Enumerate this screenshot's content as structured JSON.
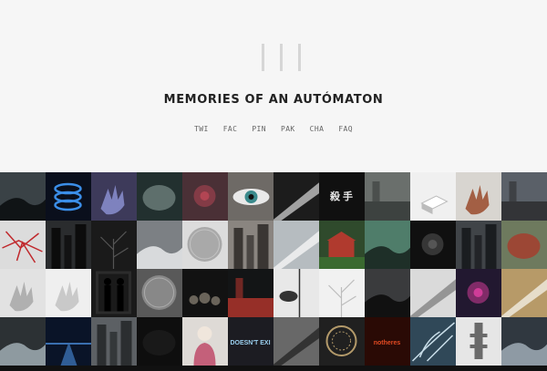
{
  "site": {
    "title": "MEMORIES OF AN AUTÓMATON"
  },
  "nav": [
    {
      "label": "TWI"
    },
    {
      "label": "FAC"
    },
    {
      "label": "PIN"
    },
    {
      "label": "PAK"
    },
    {
      "label": "CHA"
    },
    {
      "label": "FAQ"
    }
  ],
  "grid": {
    "rows": [
      [
        {
          "bg": "#3a4246",
          "accent": "#101416",
          "shape": "hill"
        },
        {
          "bg": "#0a0f1c",
          "accent": "#3b8ee8",
          "shape": "spiral"
        },
        {
          "bg": "#3d3a5a",
          "accent": "#8a8fd0",
          "shape": "hand"
        },
        {
          "bg": "#22302f",
          "accent": "#6e7f7c",
          "shape": "blob"
        },
        {
          "bg": "#4a3036",
          "accent": "#b24553",
          "shape": "glow"
        },
        {
          "bg": "#6e6a66",
          "accent": "#3b8a8c",
          "shape": "eye"
        },
        {
          "bg": "#1c1c1c",
          "accent": "#b8b8b8",
          "shape": "diag"
        },
        {
          "bg": "#101010",
          "accent": "#e6e6e6",
          "shape": "text",
          "text": "殺 手"
        },
        {
          "bg": "#6a6f6c",
          "accent": "#2b2f2e",
          "shape": "room"
        },
        {
          "bg": "#f0f0f0",
          "accent": "#bcbcbc",
          "shape": "box"
        },
        {
          "bg": "#d8d5d0",
          "accent": "#9a4a2c",
          "shape": "hand"
        },
        {
          "bg": "#5a6068",
          "accent": "#222",
          "shape": "room"
        }
      ],
      [
        {
          "bg": "#dcdcdc",
          "accent": "#c0282c",
          "shape": "lines"
        },
        {
          "bg": "#2a2c2e",
          "accent": "#0c0c0c",
          "shape": "towers"
        },
        {
          "bg": "#1a1a1a",
          "accent": "#555",
          "shape": "branch"
        },
        {
          "bg": "#7c8084",
          "accent": "#d8dadc",
          "shape": "hill"
        },
        {
          "bg": "#dcdcdc",
          "accent": "#a9a9a9",
          "shape": "moon"
        },
        {
          "bg": "#8a8580",
          "accent": "#3a3633",
          "shape": "towers"
        },
        {
          "bg": "#b6bcc0",
          "accent": "#f2f2f2",
          "shape": "diag"
        },
        {
          "bg": "#2f4a2c",
          "accent": "#b03a2e",
          "shape": "house"
        },
        {
          "bg": "#4f7d6a",
          "accent": "#1e2f28",
          "shape": "hill"
        },
        {
          "bg": "#101010",
          "accent": "#555",
          "shape": "glow"
        },
        {
          "bg": "#404448",
          "accent": "#1a1d20",
          "shape": "towers"
        },
        {
          "bg": "#6e7a5e",
          "accent": "#a83b2a",
          "shape": "blob"
        }
      ],
      [
        {
          "bg": "#e2e2e2",
          "accent": "#a7a7a7",
          "shape": "hand"
        },
        {
          "bg": "#efefef",
          "accent": "#c2c2c2",
          "shape": "hand"
        },
        {
          "bg": "#1a1a1a",
          "accent": "#2c2c2c",
          "shape": "people"
        },
        {
          "bg": "#595959",
          "accent": "#888",
          "shape": "moon"
        },
        {
          "bg": "#121212",
          "accent": "#6a645a",
          "shape": "dots"
        },
        {
          "bg": "#131516",
          "accent": "#cf3a30",
          "shape": "room"
        },
        {
          "bg": "#e8e8e8",
          "accent": "#333",
          "shape": "lamp"
        },
        {
          "bg": "#f1f1f1",
          "accent": "#bdbdbd",
          "shape": "branch"
        },
        {
          "bg": "#3a3b3d",
          "accent": "#111",
          "shape": "hill"
        },
        {
          "bg": "#dadada",
          "accent": "#888",
          "shape": "diag"
        },
        {
          "bg": "#221830",
          "accent": "#d03c98",
          "shape": "glow"
        },
        {
          "bg": "#b79a68",
          "accent": "#efe9dc",
          "shape": "diag"
        }
      ],
      [
        {
          "bg": "#2c3134",
          "accent": "#8e9aa0",
          "shape": "hill"
        },
        {
          "bg": "#0a1428",
          "accent": "#3a6fb0",
          "shape": "road"
        },
        {
          "bg": "#5c6064",
          "accent": "#2b2e30",
          "shape": "towers"
        },
        {
          "bg": "#0e0e0e",
          "accent": "#1d1d1d",
          "shape": "blob"
        },
        {
          "bg": "#dedad6",
          "accent": "#c4607a",
          "shape": "face"
        },
        {
          "bg": "#1c1c22",
          "accent": "#9bd0f0",
          "shape": "text",
          "text": "DOESN'T EXI"
        },
        {
          "bg": "#686868",
          "accent": "#2a2a2a",
          "shape": "diag"
        },
        {
          "bg": "#202020",
          "accent": "#b39a6a",
          "shape": "ring"
        },
        {
          "bg": "#2a0a05",
          "accent": "#e24a22",
          "shape": "text",
          "text": "notheres"
        },
        {
          "bg": "#304858",
          "accent": "#c8dde8",
          "shape": "feather"
        },
        {
          "bg": "#e6e6e6",
          "accent": "#6a6a6a",
          "shape": "tower"
        },
        {
          "bg": "#303840",
          "accent": "#8e9aa4",
          "shape": "hill"
        }
      ]
    ]
  }
}
